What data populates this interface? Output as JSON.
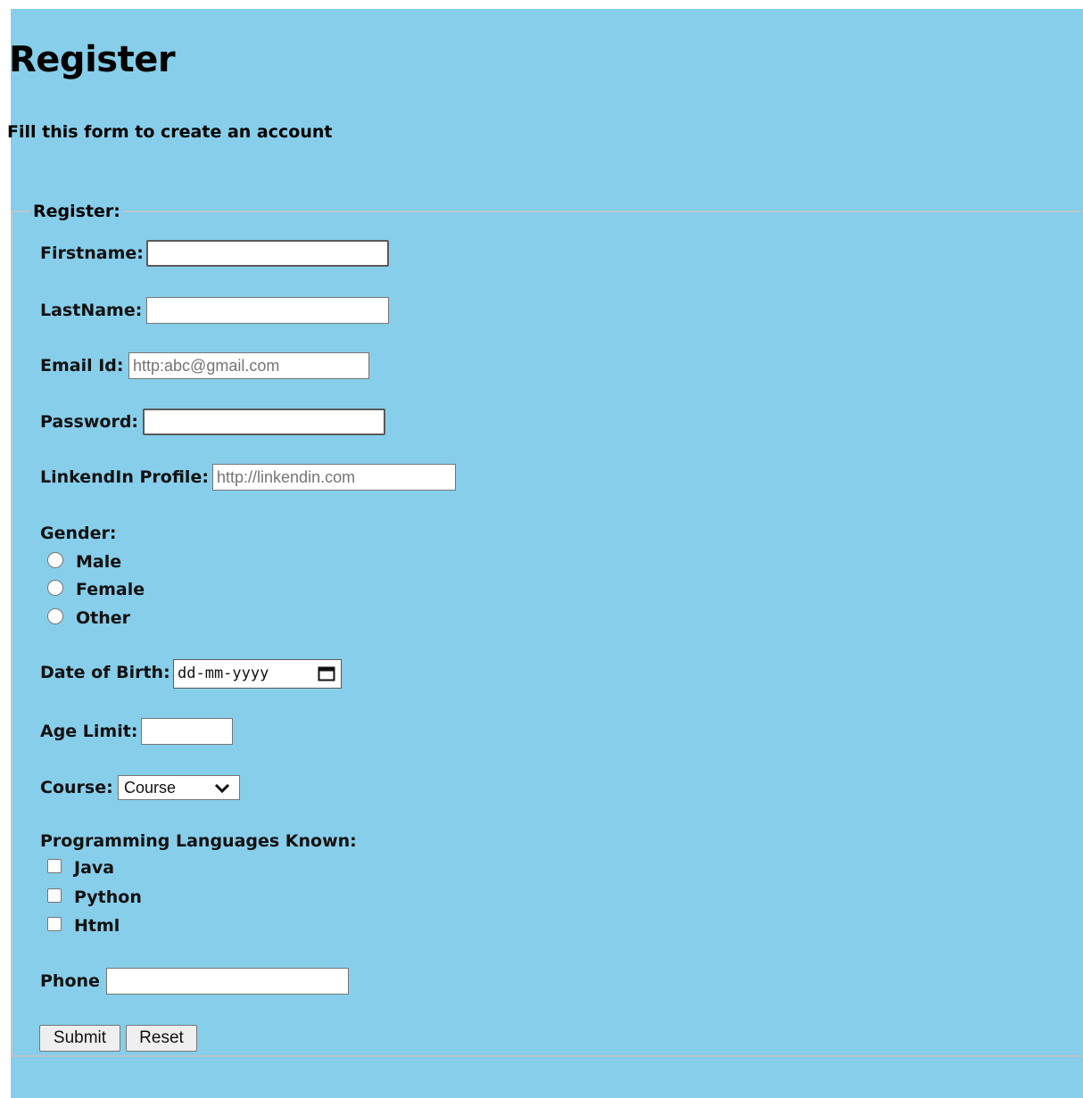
{
  "page": {
    "title": "Register",
    "subtitle": "Fill this form to create an account",
    "background_color": "#87ceea"
  },
  "form": {
    "legend": "Register:",
    "firstname": {
      "label": "Firstname:",
      "value": ""
    },
    "lastname": {
      "label": "LastName:",
      "value": ""
    },
    "email": {
      "label": "Email Id:",
      "placeholder": "http:abc@gmail.com"
    },
    "password": {
      "label": "Password:",
      "value": ""
    },
    "linkedin": {
      "label": "LinkendIn Profile:",
      "placeholder": "http://linkendin.com"
    },
    "gender": {
      "label": "Gender:",
      "options": [
        "Male",
        "Female",
        "Other"
      ]
    },
    "dob": {
      "label": "Date of Birth:",
      "placeholder": "dd-mm-yyyy",
      "icon": "calendar-icon"
    },
    "age": {
      "label": "Age Limit:",
      "value": ""
    },
    "course": {
      "label": "Course:",
      "selected": "Course",
      "icon": "chevron-down-icon"
    },
    "languages": {
      "label": "Programming Languages Known:",
      "options": [
        "Java",
        "Python",
        "Html"
      ]
    },
    "phone": {
      "label": "Phone",
      "value": ""
    },
    "submit_label": "Submit",
    "reset_label": "Reset"
  }
}
